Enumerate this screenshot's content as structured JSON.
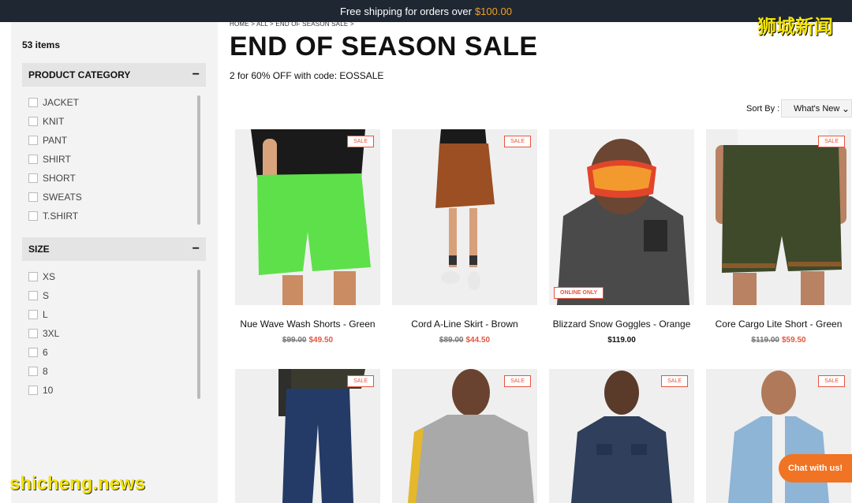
{
  "topbar": {
    "text": "Free shipping for orders over",
    "amount": "$100.00"
  },
  "sidebar": {
    "count": "53 items",
    "category": {
      "title": "PRODUCT CATEGORY",
      "toggle": "−",
      "items": [
        "JACKET",
        "KNIT",
        "PANT",
        "SHIRT",
        "SHORT",
        "SWEATS",
        "T.SHIRT"
      ]
    },
    "size": {
      "title": "SIZE",
      "toggle": "−",
      "items": [
        "XS",
        "S",
        "L",
        "3XL",
        "6",
        "8",
        "10"
      ]
    }
  },
  "breadcrumb": "HOME  >  ALL  >  END OF SEASON SALE  >",
  "page": {
    "title": "END OF SEASON SALE",
    "subtitle": "2 for 60% OFF with code: EOSSALE"
  },
  "sort": {
    "label": "Sort By :",
    "selected": "What's New"
  },
  "products": [
    {
      "name": "Nue Wave Wash Shorts - Green",
      "old_price": "$99.00",
      "price": "$49.50",
      "tag": "SALE"
    },
    {
      "name": "Cord A-Line Skirt - Brown",
      "old_price": "$89.00",
      "price": "$44.50",
      "tag": "SALE"
    },
    {
      "name": "Blizzard Snow Goggles - Orange",
      "price": "$119.00",
      "tag": "ONLINE ONLY"
    },
    {
      "name": "Core Cargo Lite Short - Green",
      "old_price": "$119.00",
      "price": "$59.50",
      "tag": "SALE"
    },
    {
      "tag": "SALE"
    },
    {
      "tag": "SALE"
    },
    {
      "tag": "SALE"
    },
    {
      "tag": "SALE"
    }
  ],
  "chat": {
    "label": "Chat with us!"
  },
  "watermarks": {
    "cn": "狮城新闻",
    "en": "shicheng.news"
  },
  "colors": {
    "accent": "#e8543e",
    "topbar": "#1f2733",
    "chat": "#f07424",
    "shorts_green": "#5ee04a"
  }
}
